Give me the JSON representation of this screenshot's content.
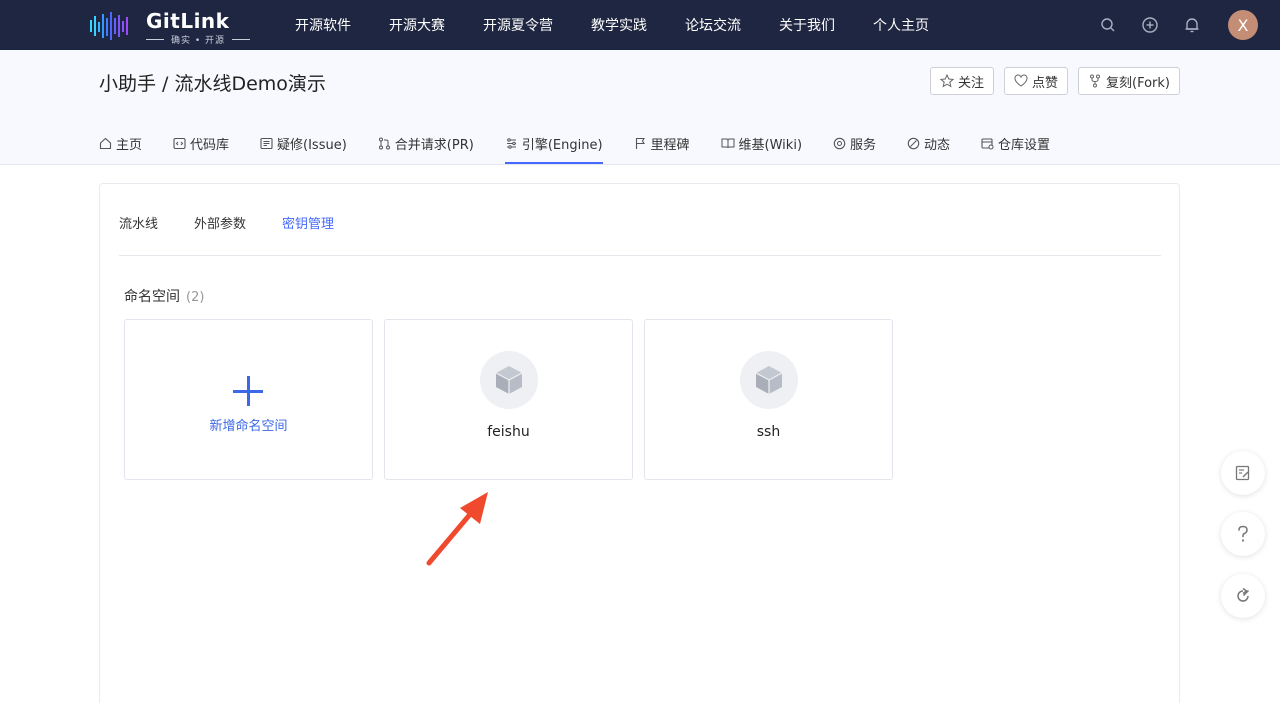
{
  "logo": {
    "brand": "GitLink",
    "slogan": "确实 • 开源"
  },
  "nav": {
    "items": [
      "开源软件",
      "开源大赛",
      "开源夏令营",
      "教学实践",
      "论坛交流",
      "关于我们",
      "个人主页"
    ]
  },
  "user": {
    "avatar_letter": "X"
  },
  "repo": {
    "title": "小助手 / 流水线Demo演示",
    "buttons": {
      "watch": "关注",
      "like": "点赞",
      "fork": "复刻(Fork)"
    },
    "tabs": [
      "主页",
      "代码库",
      "疑修(Issue)",
      "合并请求(PR)",
      "引擎(Engine)",
      "里程碑",
      "维基(Wiki)",
      "服务",
      "动态",
      "仓库设置"
    ],
    "active_tab": "引擎(Engine)"
  },
  "subtabs": {
    "items": [
      "流水线",
      "外部参数",
      "密钥管理"
    ],
    "active": "密钥管理"
  },
  "namespaces": {
    "title": "命名空间",
    "count": "(2)",
    "add_label": "新增命名空间",
    "items": [
      "feishu",
      "ssh"
    ]
  },
  "colors": {
    "nav_bg": "#1f2641",
    "accent": "#466aff",
    "link_blue": "#3d68e5",
    "arrow": "#f04a2e"
  }
}
